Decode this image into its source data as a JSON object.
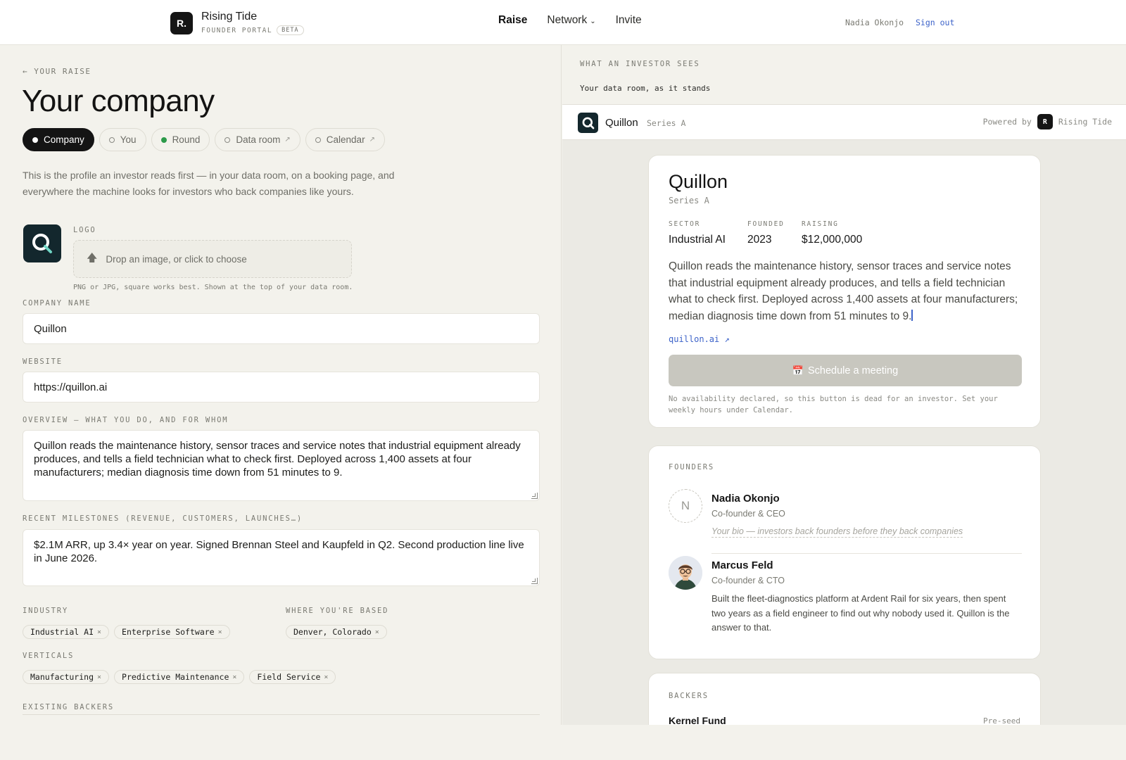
{
  "header": {
    "brand_logo_letter": "R.",
    "brand_name": "Rising Tide",
    "brand_sub": "FOUNDER PORTAL",
    "brand_badge": "BETA",
    "nav": [
      {
        "label": "Raise",
        "active": true
      },
      {
        "label": "Network",
        "dropdown": true
      },
      {
        "label": "Invite"
      }
    ],
    "user_name": "Nadia Okonjo",
    "signout_label": "Sign out"
  },
  "left": {
    "crumb": "← YOUR RAISE",
    "title": "Your company",
    "tabs": [
      {
        "label": "Company",
        "state": "active"
      },
      {
        "label": "You",
        "state": "empty"
      },
      {
        "label": "Round",
        "state": "done"
      },
      {
        "label": "Data room",
        "state": "empty",
        "external": "↗"
      },
      {
        "label": "Calendar",
        "state": "empty",
        "external": "↗"
      }
    ],
    "intro": "This is the profile an investor reads first — in your data room, on a booking page, and everywhere the machine looks for investors who back companies like yours.",
    "logo_label": "LOGO",
    "drop_text": "Drop an image, or click to choose",
    "drop_hint": "PNG or JPG, square works best. Shown at the top of your data room.",
    "company_name_label": "COMPANY NAME",
    "company_name_value": "Quillon",
    "website_label": "WEBSITE",
    "website_value": "https://quillon.ai",
    "overview_label": "OVERVIEW — WHAT YOU DO, AND FOR WHOM",
    "overview_value": "Quillon reads the maintenance history, sensor traces and service notes that industrial equipment already produces, and tells a field technician what to check first. Deployed across 1,400 assets at four manufacturers; median diagnosis time down from 51 minutes to 9.",
    "milestones_label": "RECENT MILESTONES (REVENUE, CUSTOMERS, LAUNCHES…)",
    "milestones_value": "$2.1M ARR, up 3.4× year on year. Signed Brennan Steel and Kaupfeld in Q2. Second production line live in June 2026.",
    "industry_label": "INDUSTRY",
    "industry_chips": [
      "Industrial AI",
      "Enterprise Software"
    ],
    "based_label": "WHERE YOU'RE BASED",
    "based_chips": [
      "Denver, Colorado"
    ],
    "verticals_label": "VERTICALS",
    "vertical_chips": [
      "Manufacturing",
      "Predictive Maintenance",
      "Field Service"
    ],
    "backers_label": "EXISTING BACKERS",
    "remove_glyph": "×"
  },
  "right": {
    "section_label": "WHAT AN INVESTOR SEES",
    "section_sub": "Your data room, as it stands",
    "dataroom": {
      "company": "Quillon",
      "stage": "Series A",
      "powered_by": "Powered by",
      "powered_logo": "R",
      "powered_name": "Rising Tide"
    },
    "profile": {
      "title": "Quillon",
      "stage": "Series A",
      "stats": [
        {
          "label": "SECTOR",
          "value": "Industrial AI"
        },
        {
          "label": "FOUNDED",
          "value": "2023"
        },
        {
          "label": "RAISING",
          "value": "$12,000,000"
        }
      ],
      "overview": "Quillon reads the maintenance history, sensor traces and service notes that industrial equipment already produces, and tells a field technician what to check first. Deployed across 1,400 assets at four manufacturers; median diagnosis time down from 51 minutes to 9.",
      "link": "quillon.ai ↗",
      "schedule_icon": "📅",
      "schedule_label": "Schedule a meeting",
      "note": "No availability declared, so this button is dead for an investor. Set your weekly hours under Calendar."
    },
    "founders_label": "FOUNDERS",
    "founders": [
      {
        "initial": "N",
        "name": "Nadia Okonjo",
        "role": "Co-founder & CEO",
        "bio_placeholder": "Your bio — investors back founders before they back companies"
      },
      {
        "name": "Marcus Feld",
        "role": "Co-founder & CTO",
        "bio": "Built the fleet-diagnostics platform at Ardent Rail for six years, then spent two years as a field engineer to find out why nobody used it. Quillon is the answer to that."
      }
    ],
    "backers_label": "BACKERS",
    "backers": [
      {
        "name": "Kernel Fund",
        "stage": "Pre-seed"
      }
    ]
  }
}
